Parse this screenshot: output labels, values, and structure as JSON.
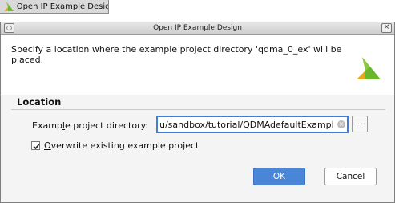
{
  "taskbar": {
    "tab_label": "Open IP Example Desig"
  },
  "dialog": {
    "title": "Open IP Example Design",
    "message": "Specify a location where the example project directory 'qdma_0_ex' will be placed.",
    "location": {
      "section_title": "Location",
      "directory_label_pre": "Examp",
      "directory_label_mnemonic": "l",
      "directory_label_post": "e project directory:",
      "directory_value": "u/sandbox/tutorial/QDMAdefaultExample",
      "browse_label": "···",
      "overwrite_mnemonic": "O",
      "overwrite_label_rest": "verwrite existing example project",
      "overwrite_checked": true
    },
    "buttons": {
      "ok": "OK",
      "cancel": "Cancel"
    },
    "colors": {
      "accent": "#4a86d8",
      "logo_green": "#6bb62b",
      "logo_yellow": "#e7a81e"
    }
  }
}
